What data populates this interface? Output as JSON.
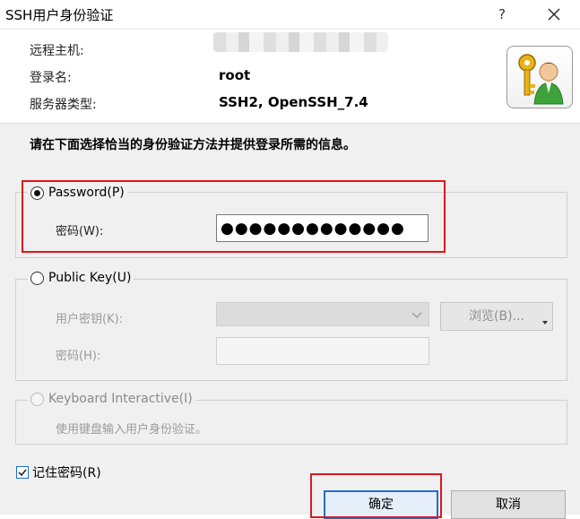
{
  "window": {
    "title": "SSH用户身份验证",
    "help_label": "?",
    "close_icon": "close-icon"
  },
  "header": {
    "host_label": "远程主机:",
    "login_label": "登录名:",
    "login_value": "root",
    "server_type_label": "服务器类型:",
    "server_type_value": "SSH2, OpenSSH_7.4",
    "avatar_icon": "user-key-icon"
  },
  "instruction": "请在下面选择恰当的身份验证方法并提供登录所需的信息。",
  "password_method": {
    "label": "Password(P)",
    "selected": true,
    "field_label": "密码(W):",
    "field_value": "●●●●●●●●●●●●●"
  },
  "public_key_method": {
    "label": "Public Key(U)",
    "selected": false,
    "user_key_label": "用户密钥(K):",
    "browse_label": "浏览(B)...",
    "passphrase_label": "密码(H):"
  },
  "keyboard_method": {
    "label": "Keyboard Interactive(I)",
    "selected": false,
    "description": "使用键盘输入用户身份验证。"
  },
  "remember": {
    "label": "记住密码(R)",
    "checked": true
  },
  "buttons": {
    "ok": "确定",
    "cancel": "取消"
  },
  "colors": {
    "highlight_red": "#e0161d",
    "accent_blue": "#1f6fce",
    "dialog_bg": "#f0f0f0"
  }
}
